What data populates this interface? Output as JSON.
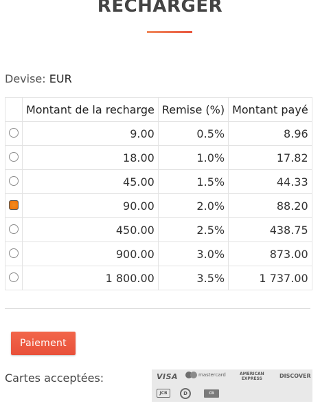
{
  "page": {
    "title": "RECHARGER"
  },
  "currency": {
    "label": "Devise:",
    "value": "EUR"
  },
  "table": {
    "headers": {
      "amount": "Montant de la recharge",
      "discount": "Remise (%)",
      "paid": "Montant payé"
    },
    "rows": [
      {
        "amount": "9.00",
        "discount": "0.5%",
        "paid": "8.96",
        "selected": false
      },
      {
        "amount": "18.00",
        "discount": "1.0%",
        "paid": "17.82",
        "selected": false
      },
      {
        "amount": "45.00",
        "discount": "1.5%",
        "paid": "44.33",
        "selected": false
      },
      {
        "amount": "90.00",
        "discount": "2.0%",
        "paid": "88.20",
        "selected": true
      },
      {
        "amount": "450.00",
        "discount": "2.5%",
        "paid": "438.75",
        "selected": false
      },
      {
        "amount": "900.00",
        "discount": "3.0%",
        "paid": "873.00",
        "selected": false
      },
      {
        "amount": "1 800.00",
        "discount": "3.5%",
        "paid": "1 737.00",
        "selected": false
      }
    ]
  },
  "payment": {
    "button_label": "Paiement"
  },
  "cards": {
    "label": "Cartes acceptées:",
    "logos": {
      "visa": "VISA",
      "mastercard": "mastercard",
      "amex_line1": "AMERICAN",
      "amex_line2": "EXPRESS",
      "discover": "DISCOVER",
      "jcb": "JCB",
      "diners": "D",
      "cb": "CB"
    }
  },
  "colors": {
    "accent": "#e9573f",
    "radio_selected": "#f07c12"
  }
}
